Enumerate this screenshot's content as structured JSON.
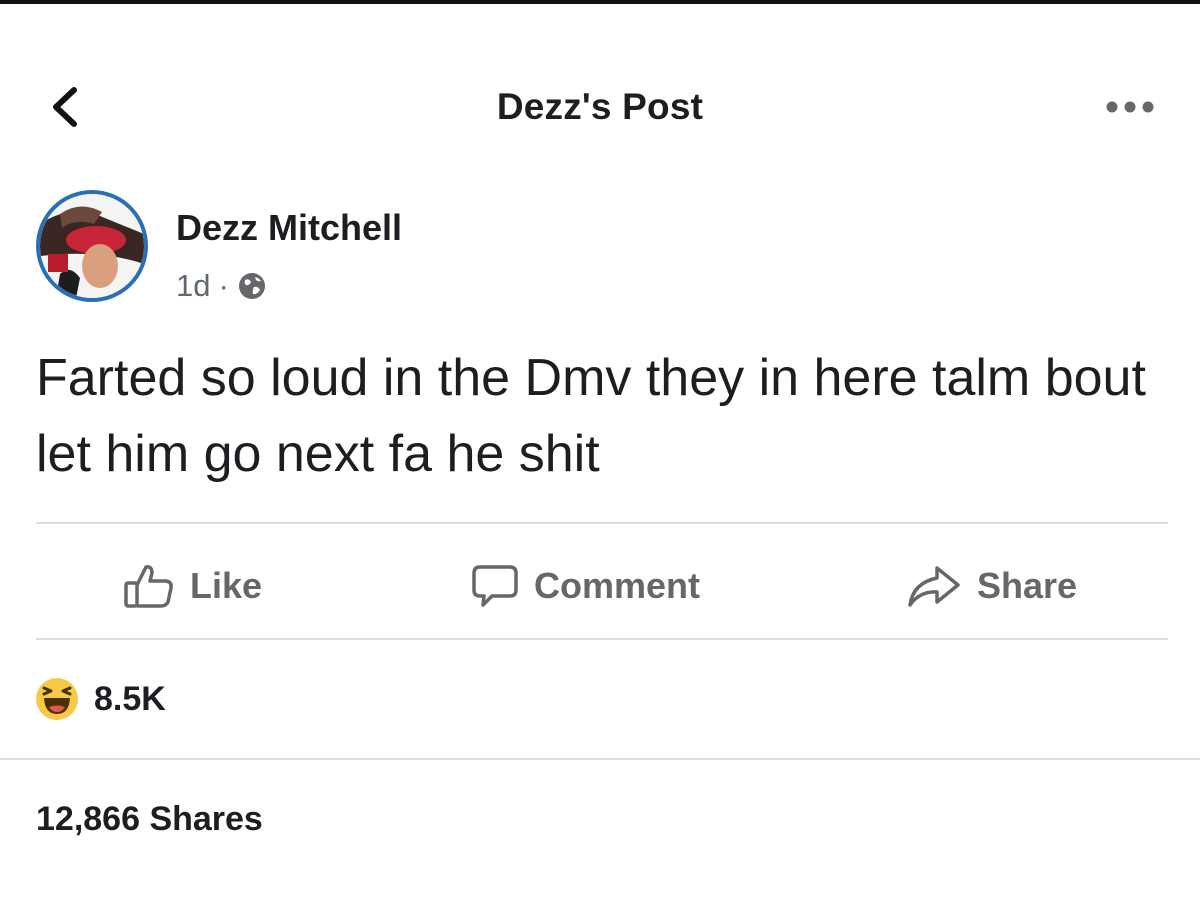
{
  "header": {
    "title": "Dezz's Post",
    "back_icon": "chevron-left-icon",
    "more_icon": "more-horizontal-icon"
  },
  "post": {
    "author": "Dezz Mitchell",
    "timestamp": "1d",
    "separator": "·",
    "privacy_icon": "globe-icon",
    "text": "Farted so loud in the Dmv they in here talm bout let him go next fa he shit"
  },
  "actions": {
    "like_label": "Like",
    "comment_label": "Comment",
    "share_label": "Share"
  },
  "reactions": {
    "emoji": "laughing-emoji-icon",
    "count": "8.5K"
  },
  "shares": {
    "label": "12,866 Shares"
  },
  "colors": {
    "text_primary": "#1c1e21",
    "text_secondary": "#65676b",
    "divider": "#dadde1",
    "avatar_ring": "#2a6fb5",
    "emoji_yellow": "#f7c948"
  }
}
